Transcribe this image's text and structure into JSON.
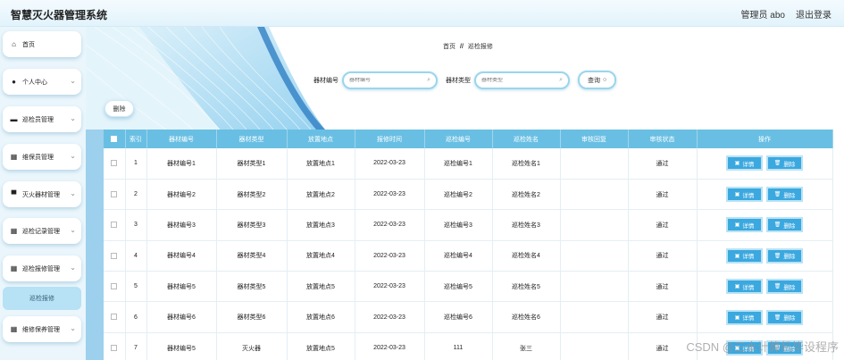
{
  "app": {
    "title": "智慧灭火器管理系统",
    "user_label": "管理员 abo",
    "logout_label": "退出登录"
  },
  "sidebar": {
    "items": [
      {
        "label": "首页",
        "icon": "home-icon",
        "glyph": "⌂"
      },
      {
        "label": "个人中心",
        "icon": "user-icon",
        "glyph": "●"
      },
      {
        "label": "巡检员管理",
        "icon": "briefcase-icon",
        "glyph": "▬"
      },
      {
        "label": "维保员管理",
        "icon": "grid-icon",
        "glyph": "▦"
      },
      {
        "label": "灭火器材管理",
        "icon": "monitor-icon",
        "glyph": "▀"
      },
      {
        "label": "巡检记录管理",
        "icon": "grid-icon",
        "glyph": "▦"
      },
      {
        "label": "巡检报修管理",
        "icon": "grid-icon",
        "glyph": "▦"
      },
      {
        "label": "维修保养管理",
        "icon": "grid-icon",
        "glyph": "▦"
      }
    ],
    "active_submenu": "巡检报修"
  },
  "breadcrumb": {
    "home": "首页",
    "separator": "//",
    "current": "巡检报修"
  },
  "search": {
    "field1_label": "器材编号",
    "field1_placeholder": "器材编号",
    "field2_label": "器材类型",
    "field2_placeholder": "器材类型",
    "query_label": "查询"
  },
  "toolbar": {
    "delete_label": "删除"
  },
  "table": {
    "headers": [
      "",
      "索引",
      "器材编号",
      "器材类型",
      "放置地点",
      "报修时间",
      "巡检编号",
      "巡检姓名",
      "审核回复",
      "审核状态",
      "操作"
    ],
    "detail_label": "详情",
    "delete_label": "删除",
    "rows": [
      {
        "idx": "1",
        "code": "器材编号1",
        "type": "器材类型1",
        "place": "放置地点1",
        "time": "2022-03-23",
        "inspect_no": "巡检编号1",
        "inspector": "巡检姓名1",
        "reply": "",
        "status": "通过"
      },
      {
        "idx": "2",
        "code": "器材编号2",
        "type": "器材类型2",
        "place": "放置地点2",
        "time": "2022-03-23",
        "inspect_no": "巡检编号2",
        "inspector": "巡检姓名2",
        "reply": "",
        "status": "通过"
      },
      {
        "idx": "3",
        "code": "器材编号3",
        "type": "器材类型3",
        "place": "放置地点3",
        "time": "2022-03-23",
        "inspect_no": "巡检编号3",
        "inspector": "巡检姓名3",
        "reply": "",
        "status": "通过"
      },
      {
        "idx": "4",
        "code": "器材编号4",
        "type": "器材类型4",
        "place": "放置地点4",
        "time": "2022-03-23",
        "inspect_no": "巡检编号4",
        "inspector": "巡检姓名4",
        "reply": "",
        "status": "通过"
      },
      {
        "idx": "5",
        "code": "器材编号5",
        "type": "器材类型5",
        "place": "放置地点5",
        "time": "2022-03-23",
        "inspect_no": "巡检编号5",
        "inspector": "巡检姓名5",
        "reply": "",
        "status": "通过"
      },
      {
        "idx": "6",
        "code": "器材编号6",
        "type": "器材类型6",
        "place": "放置地点6",
        "time": "2022-03-23",
        "inspect_no": "巡检编号6",
        "inspector": "巡检姓名6",
        "reply": "",
        "status": "通过"
      },
      {
        "idx": "7",
        "code": "器材编号5",
        "type": "灭火器",
        "place": "放置地点5",
        "time": "2022-03-23",
        "inspect_no": "111",
        "inspector": "张三",
        "reply": "",
        "status": "通过"
      }
    ]
  },
  "watermark": "CSDN @三水计算机毕设程序",
  "colors": {
    "header": "#69bfe3",
    "button": "#3ba8df",
    "submenu_active": "#b7e1f4"
  }
}
